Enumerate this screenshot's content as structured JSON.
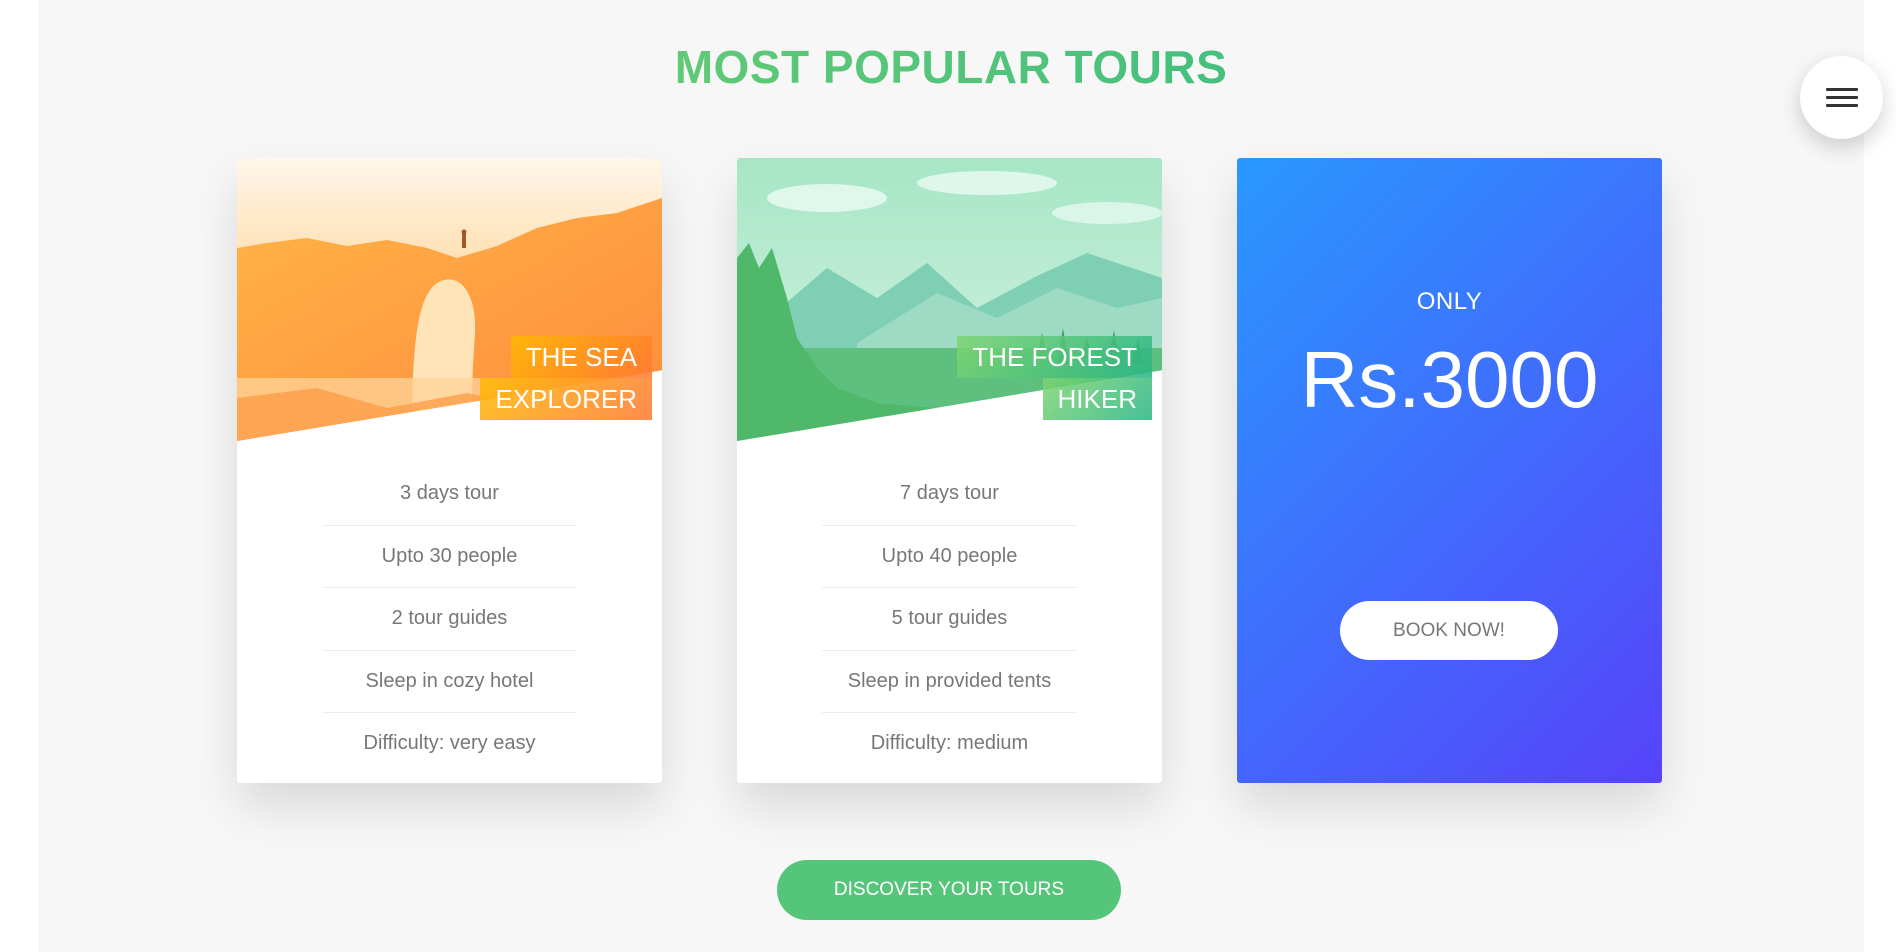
{
  "section": {
    "title": "MOST POPULAR TOURS"
  },
  "nav": {
    "icon": "hamburger-menu-icon"
  },
  "cards": [
    {
      "heading_line_1": "THE SEA",
      "heading_line_2": "EXPLORER",
      "image": "sea-rock-arch-image",
      "accent_colors": [
        "#ffb900",
        "#ff7730"
      ],
      "details": [
        "3 days tour",
        "Upto 30 people",
        "2 tour guides",
        "Sleep in cozy hotel",
        "Difficulty: very easy"
      ]
    },
    {
      "heading_line_1": "THE FOREST",
      "heading_line_2": "HIKER",
      "image": "forest-mountain-image",
      "accent_colors": [
        "#7ed56f",
        "#28b485"
      ],
      "details": [
        "7 days tour",
        "Upto 40 people",
        "5 tour guides",
        "Sleep in provided tents",
        "Difficulty: medium"
      ]
    }
  ],
  "price_card": {
    "label": "ONLY",
    "value": "Rs.3000",
    "button_label": "BOOK NOW!",
    "accent_colors": [
      "#2998ff",
      "#5643fa"
    ]
  },
  "discover_button": {
    "label": "DISCOVER YOUR TOURS",
    "color": "#55c57a"
  }
}
